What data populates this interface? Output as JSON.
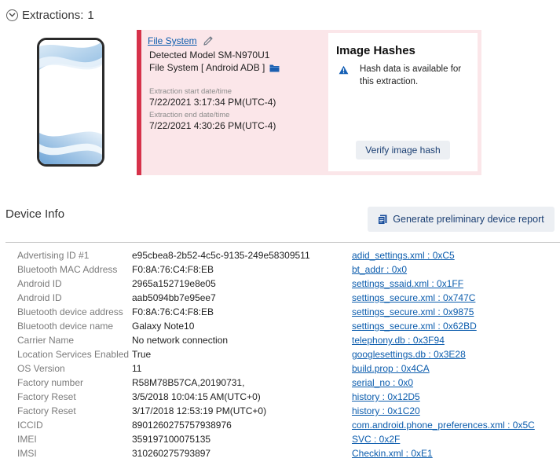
{
  "extractions": {
    "label": "Extractions:",
    "count": "1"
  },
  "extraction": {
    "source_link": "File System",
    "detected_model": "Detected Model SM-N970U1",
    "file_system": "File System [ Android ADB ]",
    "start_caption": "Extraction start date/time",
    "start_value": "7/22/2021 3:17:34 PM(UTC-4)",
    "end_caption": "Extraction end date/time",
    "end_value": "7/22/2021 4:30:26 PM(UTC-4)",
    "accent_color": "#d6324a",
    "background_color": "#fbe6e9"
  },
  "image_hashes": {
    "title": "Image Hashes",
    "message": "Hash data is available for this extraction.",
    "verify_button": "Verify image hash",
    "warning_color": "#0b5cad"
  },
  "device_info": {
    "title": "Device Info",
    "report_button": "Generate preliminary device report",
    "rows": [
      {
        "label": "Advertising ID #1",
        "value": "e95cbea8-2b52-4c5c-9135-249e58309511",
        "source": "adid_settings.xml : 0xC5"
      },
      {
        "label": "Bluetooth MAC Address",
        "value": "F0:8A:76:C4:F8:EB",
        "source": "bt_addr : 0x0"
      },
      {
        "label": "Android ID",
        "value": "2965a152719e8e05",
        "source": "settings_ssaid.xml : 0x1FF"
      },
      {
        "label": "Android ID",
        "value": "aab5094bb7e95ee7",
        "source": "settings_secure.xml : 0x747C"
      },
      {
        "label": "Bluetooth device address",
        "value": "F0:8A:76:C4:F8:EB",
        "source": "settings_secure.xml : 0x9875"
      },
      {
        "label": "Bluetooth device name",
        "value": "Galaxy Note10",
        "source": "settings_secure.xml : 0x62BD"
      },
      {
        "label": "Carrier Name",
        "value": "No network connection",
        "source": "telephony.db : 0x3F94"
      },
      {
        "label": "Location Services Enabled",
        "value": "True",
        "source": "googlesettings.db : 0x3E28"
      },
      {
        "label": "OS Version",
        "value": "11",
        "source": "build.prop : 0x4CA"
      },
      {
        "label": "Factory number",
        "value": "R58M78B57CA,20190731,",
        "source": "serial_no : 0x0"
      },
      {
        "label": "Factory Reset",
        "value": "3/5/2018 10:04:15 AM(UTC+0)",
        "source": "history : 0x12D5"
      },
      {
        "label": "Factory Reset",
        "value": "3/17/2018 12:53:19 PM(UTC+0)",
        "source": "history : 0x1C20"
      },
      {
        "label": "ICCID",
        "value": "8901260275757938976",
        "source": "com.android.phone_preferences.xml : 0x5C"
      },
      {
        "label": "IMEI",
        "value": "359197100075135",
        "source": "SVC : 0x2F"
      },
      {
        "label": "IMSI",
        "value": "310260275793897",
        "source": "Checkin.xml : 0xE1"
      }
    ]
  },
  "colors": {
    "link": "#0b5cad",
    "button_bg": "#eceff3",
    "button_text": "#1b3f73"
  }
}
